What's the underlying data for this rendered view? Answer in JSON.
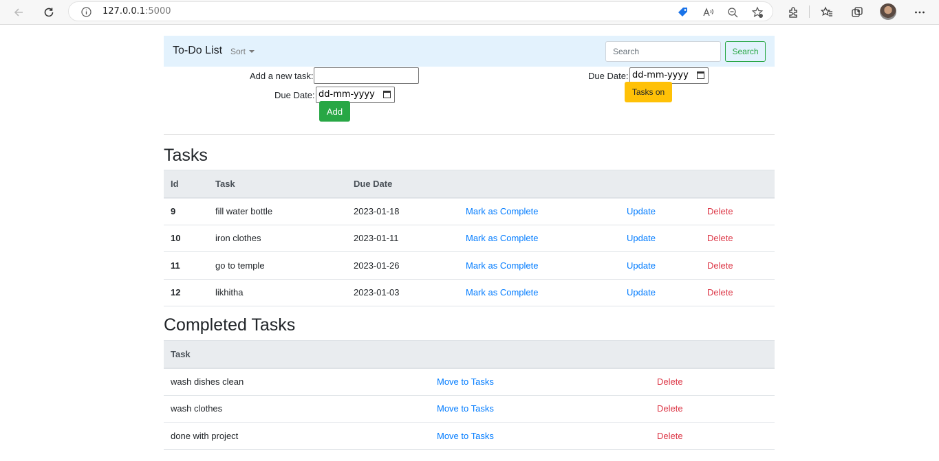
{
  "browser": {
    "url_host": "127.0.0.1",
    "url_port": ":5000"
  },
  "navbar": {
    "brand": "To-Do List",
    "sort_label": "Sort",
    "search_placeholder": "Search",
    "search_button": "Search"
  },
  "add_form": {
    "task_label": "Add a new task:",
    "due_label": "Due Date:",
    "due_placeholder": "dd-mm-yyyy",
    "add_button": "Add"
  },
  "filter_form": {
    "due_label": "Due Date:",
    "due_placeholder": "dd-mm-yyyy",
    "button": "Tasks on"
  },
  "tasks": {
    "heading": "Tasks",
    "columns": [
      "Id",
      "Task",
      "Due Date"
    ],
    "action_complete": "Mark as Complete",
    "action_update": "Update",
    "action_delete": "Delete",
    "rows": [
      {
        "id": "9",
        "task": "fill water bottle",
        "due": "2023-01-18"
      },
      {
        "id": "10",
        "task": "iron clothes",
        "due": "2023-01-11"
      },
      {
        "id": "11",
        "task": "go to temple",
        "due": "2023-01-26"
      },
      {
        "id": "12",
        "task": "likhitha",
        "due": "2023-01-03"
      }
    ]
  },
  "completed": {
    "heading": "Completed Tasks",
    "columns": [
      "Task"
    ],
    "action_move": "Move to Tasks",
    "action_delete": "Delete",
    "rows": [
      {
        "task": "wash dishes clean"
      },
      {
        "task": "wash clothes"
      },
      {
        "task": "done with project"
      }
    ]
  },
  "colors": {
    "navbar_bg": "#e3f2fd",
    "success": "#28a745",
    "warning": "#ffc107",
    "link": "#007bff",
    "danger": "#dc3545"
  },
  "icons": [
    "back-arrow-icon",
    "refresh-icon",
    "info-icon",
    "tag-icon",
    "read-aloud-icon",
    "zoom-out-icon",
    "add-favorite-icon",
    "extensions-icon",
    "favorites-icon",
    "collections-icon",
    "more-icon",
    "calendar-icon"
  ]
}
